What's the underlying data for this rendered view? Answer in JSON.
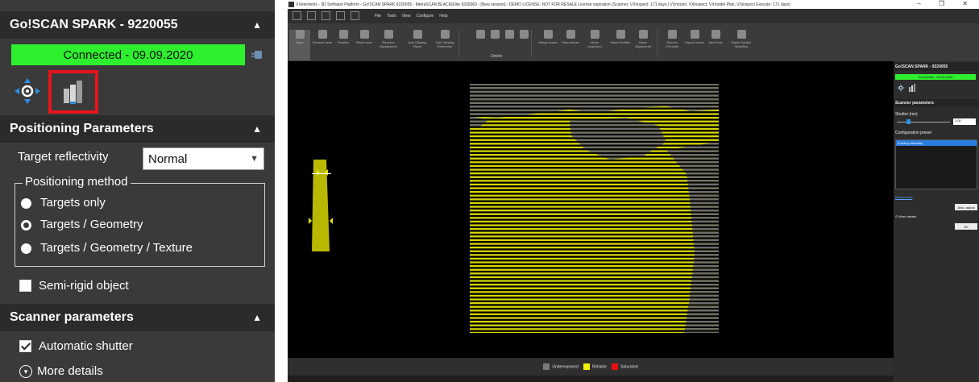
{
  "left_panel": {
    "device_header": {
      "title": "Go!SCAN SPARK - 9220055",
      "chevron": "chevron-up-icon"
    },
    "connection": {
      "status": "Connected - 09.09.2020",
      "color": "#2ef02e",
      "icon": "connection-plug-icon"
    },
    "mode_icons": [
      "positioning-mode-icon",
      "scanner-mode-icon"
    ],
    "highlight_color": "#e8141c",
    "positioning_section": {
      "title": "Positioning Parameters",
      "target_reflectivity": {
        "label": "Target reflectivity",
        "value": "Normal"
      },
      "positioning_method": {
        "label": "Positioning method",
        "options": [
          {
            "label": "Targets only",
            "selected": false
          },
          {
            "label": "Targets / Geometry",
            "selected": true
          },
          {
            "label": "Targets / Geometry / Texture",
            "selected": false
          }
        ]
      },
      "semi_rigid": {
        "label": "Semi-rigid object",
        "checked": false
      }
    },
    "scanner_section": {
      "title": "Scanner parameters",
      "automatic_shutter": {
        "label": "Automatic shutter",
        "checked": true
      },
      "more_details": "More details"
    }
  },
  "app": {
    "title": "VXelements - 3D Software Platform - Go!SCAN SPARK 9220055 - MetraSCAN BLACK|Elite 9330063 - [New session] - DEMO LICENSE: NOT FOR RESALE License expiration (Scanner, VXinspect: 171 days | VXmodel, VXinspect, VXmodel Plan, VXinspect Execute: 171 days)",
    "window_controls": "– ❐ ✕",
    "menu": [
      "File",
      "Tools",
      "View",
      "Configure",
      "Help"
    ],
    "ribbon": [
      "Scan",
      "Reverse scan",
      "Finalize",
      "Reset scan",
      "Remove Background",
      "Add Clipping Plane",
      "Use Clipping Reference",
      "Merge scans",
      "View texture",
      "Move projection",
      "Basic Entities",
      "Basic Alignments",
      "Send to VXmodel",
      "Inspect mesh",
      "Add Scan",
      "Basic Guided Workflow"
    ],
    "ribbon_group_label": "Delete",
    "legend": [
      {
        "label": "Underexposed",
        "color": "#7a7a7a"
      },
      {
        "label": "Reliable",
        "color": "#f2f200"
      },
      {
        "label": "Saturated",
        "color": "#e81010"
      }
    ],
    "side_panel": {
      "header": "Go!SCAN SPARK - 9220055",
      "connection": "Connected - 09.09.2020",
      "section": "Scanner parameters",
      "shutter_label": "Shutter (ms)",
      "shutter_value": "1.00",
      "config_label": "Configuration preset",
      "preset": "(Factory defaults)",
      "save_preset": "Save preset",
      "auto_adjust": "Auto. adjust",
      "more_details": "More details",
      "ok": "OK"
    }
  }
}
